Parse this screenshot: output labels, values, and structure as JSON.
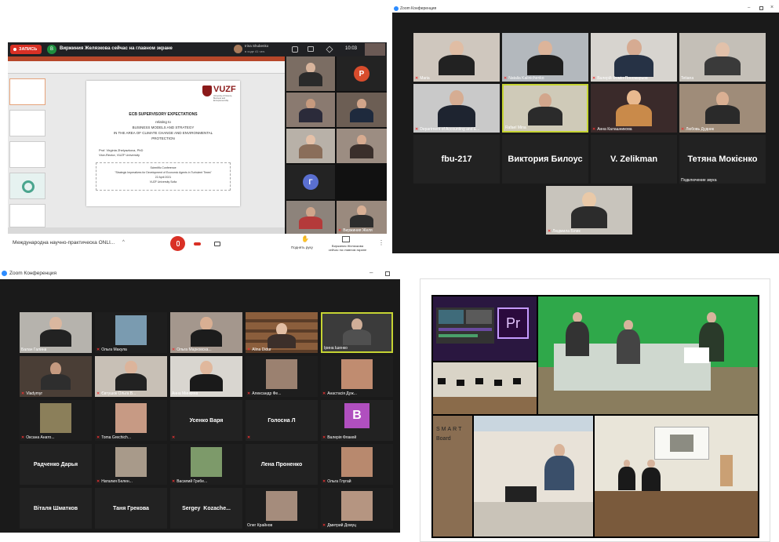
{
  "panel1": {
    "record_label": "ЗАПИСЬ",
    "presenter_initial": "В",
    "presenter_text": "Виржиния Желязкова сейчас на главном экране",
    "user_name": "Irina Shubenko",
    "user_sub": "в ходе 41 чел.",
    "clock": "10:03",
    "slide": {
      "logo": "VUZF",
      "logo_sub": "University of Finance, Business and Entrepreneurship",
      "title": "ECB SUPERVISORY EXPECTATIONS",
      "lines": [
        "relating to",
        "BUSINESS MODELS AND STRATEGY",
        "IN THE AREA OF CLIMATE CHANGE AND ENVIRONMENTAL",
        "PROTECTION"
      ],
      "author": "Prof. Virginia Zhelyazkova, PhD",
      "author_role": "Vice-Rector, VUZF University",
      "conf_lines": [
        "Scientific Conference",
        "\"Strategic Imperatives for Development of Economic Agents in Turbulent Times\"",
        "22 April 2021",
        "VUZF University Sofia"
      ]
    },
    "avatar_p": "P",
    "avatar_g": "Г",
    "tile_last_name": "Виржиния Желя",
    "bottom_title": "Международна научно-практическа ONLI...",
    "raise_hand": "Поднять руку",
    "presenter_bottom": "Виржиния Желязкова сейчас на главном экране"
  },
  "panel2": {
    "window_title": "Zoom Конференция",
    "tiles_row1": [
      "Maria",
      "Natalia Kalinichenko",
      "Валерій Фомін-Пономарьов",
      "Tetiana"
    ],
    "tiles_row2": [
      "Department of Accounting and E...",
      "Rafael Mina",
      "Анна Калашникова",
      "Любовь Дудник"
    ],
    "big_names": [
      "fbu-217",
      "Виктория Билоус",
      "V. Zelikman",
      "Тетяна Мокієнко"
    ],
    "sub_caption": "Подключение звука",
    "bottom_tile": "Людмила Білик"
  },
  "panel3": {
    "window_title": "Zoom Конференция",
    "tiles": [
      {
        "name": "Балан Галина"
      },
      {
        "name": "Ольга Макула"
      },
      {
        "name": "Ольга Марковска..."
      },
      {
        "name": "Alina Didur"
      },
      {
        "name": "Ірина Ішенко"
      },
      {
        "name": "Vladymyr"
      },
      {
        "name": "Євтушок Ольга В..."
      },
      {
        "name": "Анна Минкина"
      },
      {
        "name": "Александр Фе..."
      },
      {
        "name": "Анастасія Дуж..."
      },
      {
        "name": "Оксана Анато..."
      },
      {
        "name": "Toma Grechich..."
      },
      {
        "name": "Усенко Варя"
      },
      {
        "name": "Голосна Л"
      },
      {
        "name": "Валерія Флакей"
      },
      {
        "name": "Радченко Дарья"
      },
      {
        "name": "Наталия Белен..."
      },
      {
        "name": "Василий Гребе..."
      },
      {
        "name": "Лена Проненко"
      },
      {
        "name": "Ольга Глугай"
      },
      {
        "name": "Віталя Шматков"
      },
      {
        "name": "Таня Грекова"
      },
      {
        "name": "Sergey  Kozache..."
      },
      {
        "name": "Олег Крайнов"
      },
      {
        "name": "Дмитрий Домуц"
      }
    ],
    "avatar_b": "B"
  },
  "panel4": {
    "pr_logo": "Pr",
    "smart_brand": "SMART",
    "smart_product": "Board"
  }
}
